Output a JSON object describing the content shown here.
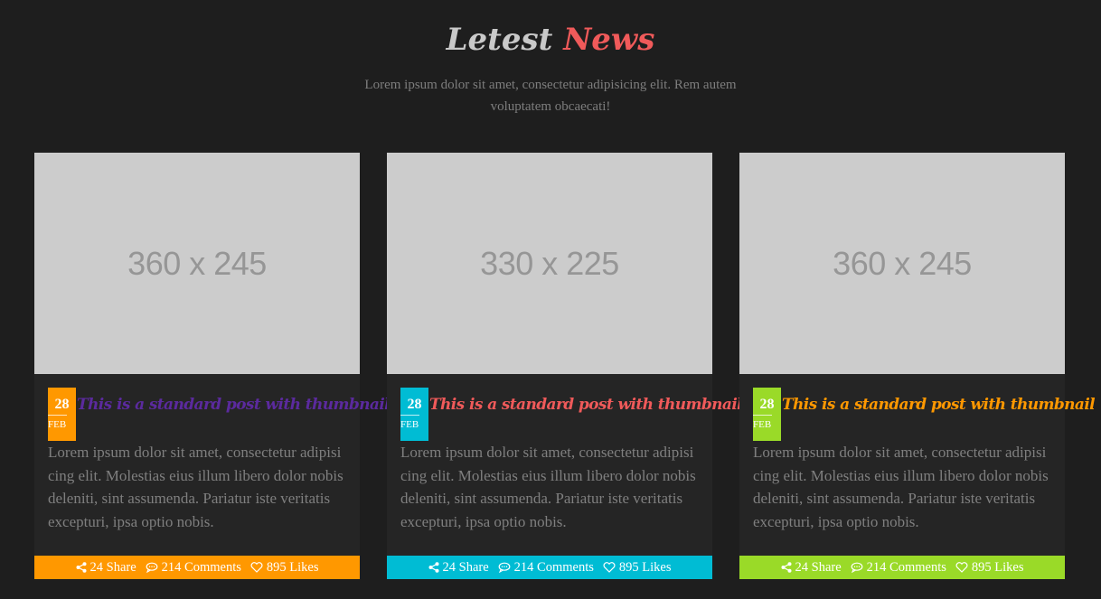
{
  "header": {
    "title_part1": "Letest",
    "title_part2": "News",
    "subtitle": "Lorem ipsum dolor sit amet, consectetur adipisicing elit. Rem autem voluptatem obcaecati!"
  },
  "colors": {
    "background": "#1e1e1e",
    "card_background": "#252525",
    "title_accent": "#f05a5a",
    "placeholder": "#cccccc"
  },
  "cards": [
    {
      "image_label": "360 x 245",
      "date_day": "28",
      "date_month": "FEB",
      "title": "This is a standard post with thumbnail",
      "body": "Lorem ipsum dolor sit amet, consectetur adipisi cing elit. Molestias eius illum libero dolor nobis deleniti, sint assumenda. Pariatur iste veritatis excepturi, ipsa optio nobis.",
      "shares": "24 Share",
      "comments": "214 Comments",
      "likes": "895 Likes",
      "accent_color": "#ff9800",
      "title_color": "#5b2a9e"
    },
    {
      "image_label": "330 x 225",
      "date_day": "28",
      "date_month": "FEB",
      "title": "This is a standard post with thumbnail",
      "body": "Lorem ipsum dolor sit amet, consectetur adipisi cing elit. Molestias eius illum libero dolor nobis deleniti, sint assumenda. Pariatur iste veritatis excepturi, ipsa optio nobis.",
      "shares": "24 Share",
      "comments": "214 Comments",
      "likes": "895 Likes",
      "accent_color": "#00bcd4",
      "title_color": "#f05a5a"
    },
    {
      "image_label": "360 x 245",
      "date_day": "28",
      "date_month": "FEB",
      "title": "This is a standard post with thumbnail",
      "body": "Lorem ipsum dolor sit amet, consectetur adipisi cing elit. Molestias eius illum libero dolor nobis deleniti, sint assumenda. Pariatur iste veritatis excepturi, ipsa optio nobis.",
      "shares": "24 Share",
      "comments": "214 Comments",
      "likes": "895 Likes",
      "accent_color": "#9ada28",
      "title_color": "#ff9800"
    }
  ],
  "icons": {
    "share": "share-icon",
    "comment": "comment-icon",
    "like": "heart-icon"
  }
}
